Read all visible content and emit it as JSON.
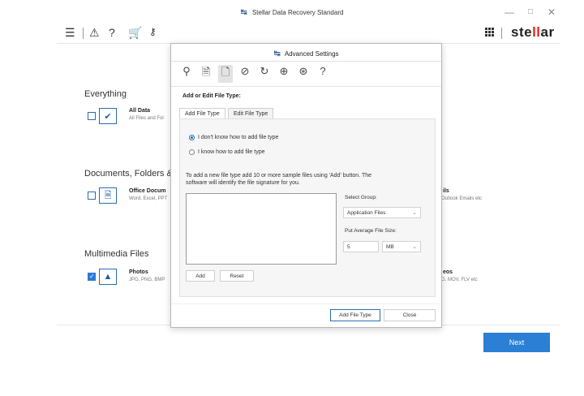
{
  "window": {
    "title": "Stellar Data Recovery Standard",
    "logo_icon": "stellar-logo-glyph",
    "controls": {
      "minimize": "—",
      "maximize": "□",
      "close": "✕"
    }
  },
  "toolbar": {
    "icons": [
      "menu-icon",
      "cleanup-icon",
      "help-icon",
      "cart-icon",
      "key-icon"
    ],
    "brand_prefix": "ste",
    "brand_highlight": "ll",
    "brand_suffix": "ar"
  },
  "page": {
    "sections": [
      {
        "title": "Everything",
        "item_title": "All Data",
        "item_sub": "All Files and Fol",
        "checked": false,
        "icon": "check-tile-icon"
      },
      {
        "title": "Documents, Folders &",
        "item_title": "Office Docum",
        "item_sub": "Word, Excel, PPT",
        "checked": false,
        "icon": "document-icon",
        "right_title": "ils",
        "right_sub": "Outlook Emails etc"
      },
      {
        "title": "Multimedia Files",
        "item_title": "Photos",
        "item_sub": "JPG, PNG, BMP",
        "checked": true,
        "icon": "photo-icon",
        "right_title": "eos",
        "right_sub": "G, MOV, FLV etc"
      }
    ],
    "next_label": "Next",
    "accent_color": "#2b7fd4"
  },
  "dialog": {
    "title": "Advanced Settings",
    "icon_bar": [
      "search-icon",
      "file-list-icon",
      "add-file-type-icon",
      "check-circle-icon",
      "refresh-icon",
      "upload-icon",
      "globe-icon",
      "help-icon"
    ],
    "active_icon_index": 2,
    "section_title": "Add or Edit File Type:",
    "tabs": [
      "Add File Type",
      "Edit File Type"
    ],
    "active_tab": "Add File Type",
    "radios": [
      {
        "label": "I don't know how to add file type",
        "selected": true
      },
      {
        "label": "I know how to add file type",
        "selected": false
      }
    ],
    "instructions_line1": "To add a new file type add 10 or more sample files using 'Add' button. The",
    "instructions_line2": "software will identify the file signature for you.",
    "select_group_label": "Select Group:",
    "select_group_value": "Application Files",
    "avg_size_label": "Put  Average File Size:",
    "avg_size_value": "5",
    "avg_size_unit": "MB",
    "add_label": "Add",
    "reset_label": "Reset",
    "add_file_type_label": "Add File Type",
    "close_label": "Close"
  }
}
